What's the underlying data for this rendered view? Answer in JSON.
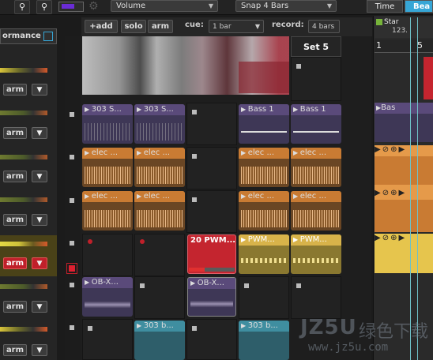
{
  "toolbar": {
    "volume_label": "Volume",
    "snap_label": "Snap 4 Bars",
    "time_label": "Time",
    "beats_label": "Bea"
  },
  "controls": {
    "add": "+add",
    "solo": "solo",
    "arm": "arm",
    "cue_label": "cue:",
    "cue_value": "1 bar",
    "record_label": "record:",
    "record_value": "4 bars"
  },
  "left": {
    "performance_label": "ormance",
    "arm_label": "arm"
  },
  "grid": {
    "set5_label": "Set 5",
    "clips": {
      "r2c1": "303 S...",
      "r2c2": "303 S...",
      "r2c4": "Bass 1",
      "r2c5": "Bass 1",
      "elec": "elec ...",
      "r5c3": "20 PWM...",
      "r5c4": "PWM...",
      "r5c5": "PWM...",
      "r6c1": "OB-X...",
      "r6c3": "OB-X...",
      "r7c2": "303 b...",
      "r7c4": "303 b..."
    }
  },
  "arrangement": {
    "marker_label": "Star",
    "marker_value": "123.",
    "ruler_1": "1",
    "ruler_5": "5",
    "clip_bass": "Bas"
  },
  "watermark": {
    "text": "JZ5U",
    "cn_text": "绿色下载",
    "url": "www.jz5u.com"
  },
  "colors": {
    "accent_blue": "#36a6d6",
    "arm_red": "#c0202a",
    "clip_purple": "#5a4a7a",
    "clip_orange": "#c97b33",
    "clip_yellow": "#d8b34a",
    "clip_teal": "#3f8ea0",
    "clip_red": "#c4252f"
  }
}
